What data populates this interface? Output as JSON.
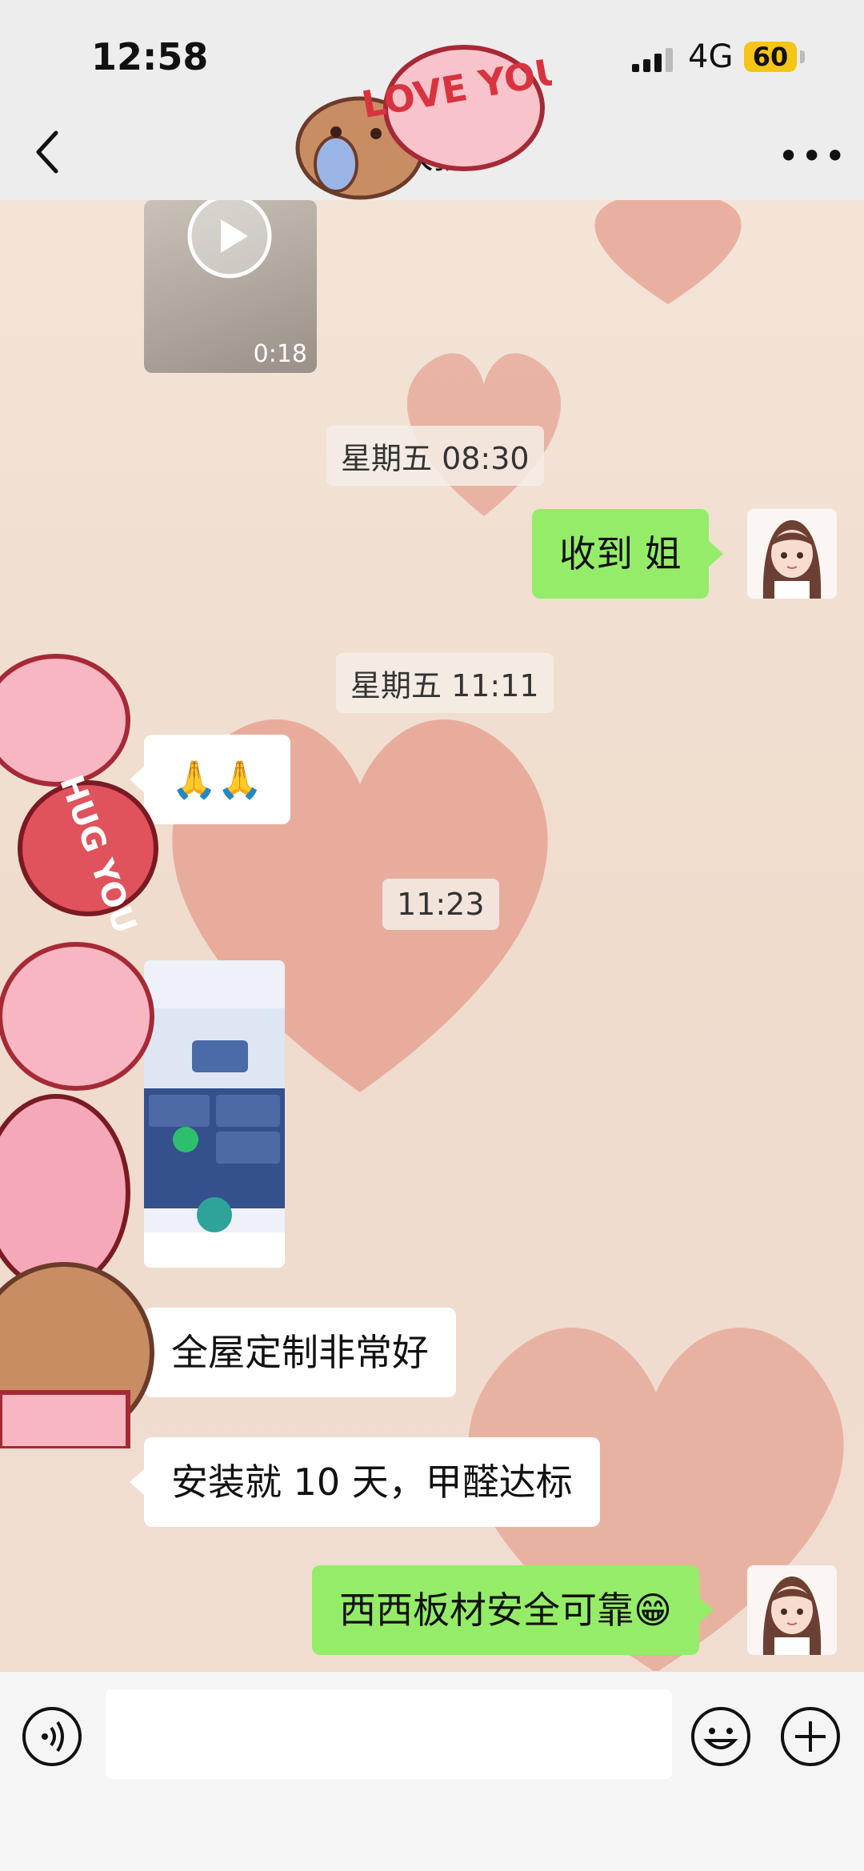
{
  "status_bar": {
    "time": "12:58",
    "network": "4G",
    "battery": "60"
  },
  "nav": {
    "title": "大孩"
  },
  "video": {
    "duration": "0:18"
  },
  "messages": [
    {
      "type": "time",
      "text": "星期五 08:30"
    },
    {
      "type": "me",
      "text": "收到 姐"
    },
    {
      "type": "time",
      "text": "星期五 11:11"
    },
    {
      "type": "them",
      "text": "🙏🙏"
    },
    {
      "type": "time",
      "text": "11:23"
    },
    {
      "type": "them",
      "text": "全屋定制非常好"
    },
    {
      "type": "them",
      "text": "安装就 10 天，甲醛达标"
    },
    {
      "type": "me",
      "text": "西西板材安全可靠😁"
    }
  ],
  "sticker": {
    "love": "LOVE YOU",
    "hug": "HUG YOU"
  },
  "colors": {
    "me_bubble": "#95ec69",
    "them_bubble": "#ffffff",
    "background": "#f1e2d6"
  }
}
